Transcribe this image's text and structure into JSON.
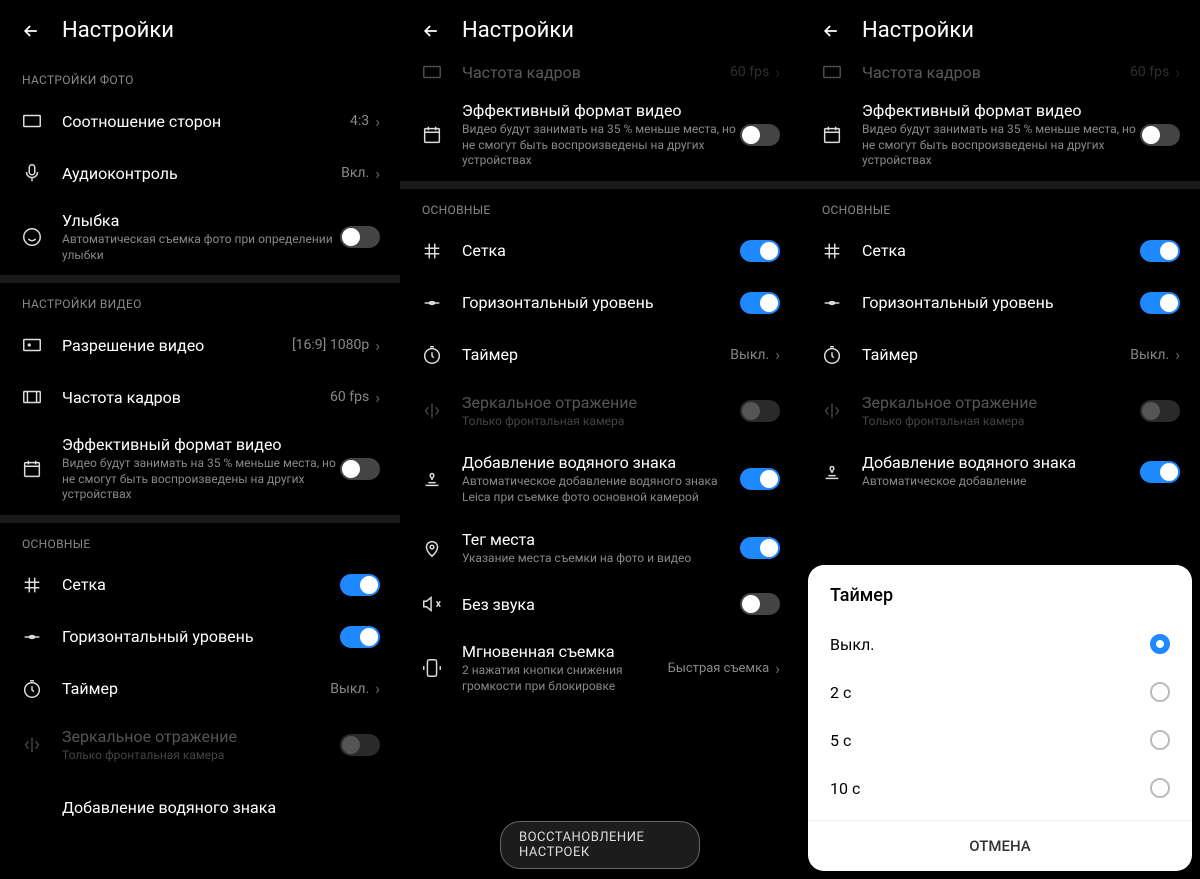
{
  "header": {
    "title": "Настройки"
  },
  "panel1": {
    "sections": {
      "photo": {
        "header": "НАСТРОЙКИ ФОТО",
        "aspect": {
          "title": "Соотношение сторон",
          "value": "4:3"
        },
        "audio": {
          "title": "Аудиоконтроль",
          "value": "Вкл."
        },
        "smile": {
          "title": "Улыбка",
          "sub": "Автоматическая съемка фото при определении улыбки"
        }
      },
      "video": {
        "header": "НАСТРОЙКИ ВИДЕО",
        "res": {
          "title": "Разрешение видео",
          "value": "[16:9] 1080p"
        },
        "fps": {
          "title": "Частота кадров",
          "value": "60 fps"
        },
        "eff": {
          "title": "Эффективный формат видео",
          "sub": "Видео будут занимать на 35 % меньше места, но не смогут быть воспроизведены на других устройствах"
        }
      },
      "main": {
        "header": "ОСНОВНЫЕ",
        "grid": {
          "title": "Сетка"
        },
        "level": {
          "title": "Горизонтальный уровень"
        },
        "timer": {
          "title": "Таймер",
          "value": "Выкл."
        },
        "mirror": {
          "title": "Зеркальное отражение",
          "sub": "Только фронтальная камера"
        },
        "wm": {
          "title": "Добавление водяного знака"
        }
      }
    }
  },
  "panel2": {
    "fps": {
      "title": "Частота кадров",
      "value": "60 fps"
    },
    "eff": {
      "title": "Эффективный формат видео",
      "sub": "Видео будут занимать на 35 % меньше места, но не смогут быть воспроизведены на других устройствах"
    },
    "main": {
      "header": "ОСНОВНЫЕ",
      "grid": {
        "title": "Сетка"
      },
      "level": {
        "title": "Горизонтальный уровень"
      },
      "timer": {
        "title": "Таймер",
        "value": "Выкл."
      },
      "mirror": {
        "title": "Зеркальное отражение",
        "sub": "Только фронтальная камера"
      },
      "wm": {
        "title": "Добавление водяного знака",
        "sub": "Автоматическое добавление водяного знака Leica при съемке фото основной камерой"
      },
      "geo": {
        "title": "Тег места",
        "sub": "Указание места съемки на фото и видео"
      },
      "mute": {
        "title": "Без звука"
      },
      "quick": {
        "title": "Мгновенная съемка",
        "sub": "2 нажатия кнопки снижения громкости при блокировке",
        "value": "Быстрая съемка"
      }
    },
    "reset": "ВОССТАНОВЛЕНИЕ НАСТРОЕК"
  },
  "panel3": {
    "wm": {
      "title": "Добавление водяного знака",
      "sub": "Автоматическое добавление"
    },
    "sheet": {
      "title": "Таймер",
      "options": [
        "Выкл.",
        "2 с",
        "5 с",
        "10 с"
      ],
      "cancel": "ОТМЕНА"
    }
  }
}
